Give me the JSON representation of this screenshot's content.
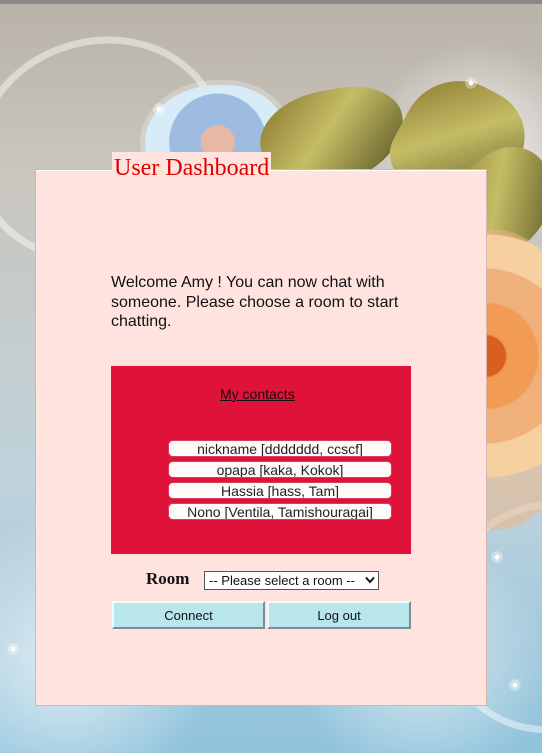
{
  "dashboard": {
    "title": "User Dashboard",
    "welcome_message": "Welcome Amy ! You can now chat with someone. Please choose a room to start chatting."
  },
  "contacts": {
    "heading": "My contacts",
    "items": [
      {
        "label": "nickname [ddddddd, ccscf]"
      },
      {
        "label": "opapa [kaka, Kokok]"
      },
      {
        "label": "Hassia [hass, Tam]"
      },
      {
        "label": "Nono [Ventila, Tamishouragai]"
      }
    ]
  },
  "room": {
    "label": "Room",
    "selected_value": "-- Please select a room --",
    "icon": "chevron-down-icon"
  },
  "actions": {
    "connect_label": "Connect",
    "logout_label": "Log out"
  },
  "colors": {
    "panel_background": "#ffe3df",
    "title_red": "#e10000",
    "contacts_background": "#df1239",
    "button_background": "#b8e6ea"
  }
}
